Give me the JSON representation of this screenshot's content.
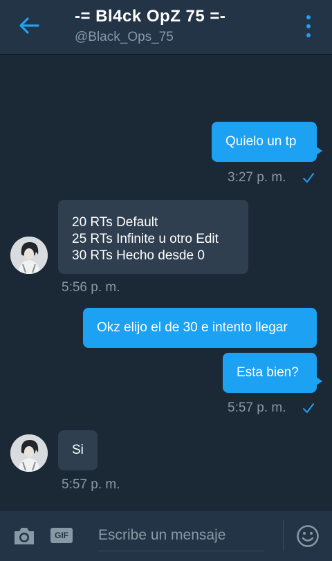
{
  "header": {
    "title": "-= Bl4ck OpZ 75 =-",
    "handle": "@Black_Ops_75",
    "back_icon": "arrow-left-icon",
    "menu_icon": "more-vertical-icon"
  },
  "colors": {
    "accent": "#1da1f2",
    "background": "#1b2836",
    "header": "#243447",
    "incoming_bubble": "#2f3f50",
    "muted_text": "#8899a6"
  },
  "messages": [
    {
      "direction": "outgoing",
      "text": "Quielo un tp",
      "time": "3:27 p. m.",
      "read": true
    },
    {
      "direction": "incoming",
      "lines": [
        "20 RTs Default",
        "25 RTs Infinite u otro Edit",
        "30 RTs Hecho desde 0"
      ],
      "time": "5:56 p. m."
    },
    {
      "direction": "outgoing",
      "text": "Okz elijo el de 30 e intento llegar"
    },
    {
      "direction": "outgoing",
      "text": "Esta bien?",
      "time": "5:57 p. m.",
      "read": true
    },
    {
      "direction": "incoming",
      "text": "Si",
      "time": "5:57 p. m."
    }
  ],
  "composer": {
    "camera_icon": "camera-icon",
    "gif_label": "GIF",
    "placeholder": "Escribe un mensaje",
    "emoji_icon": "smiley-icon"
  }
}
